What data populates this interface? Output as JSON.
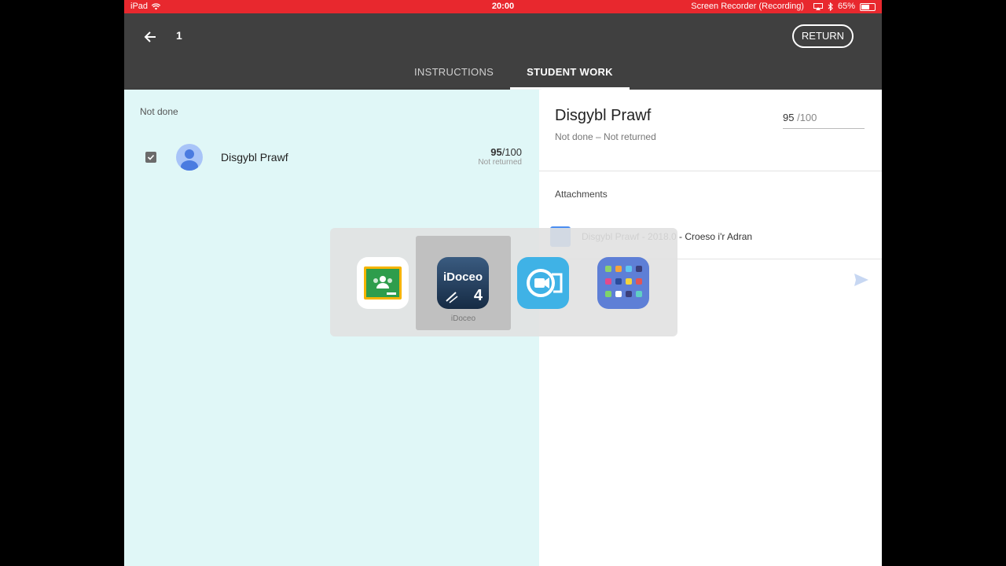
{
  "status_bar": {
    "device": "iPad",
    "time": "20:00",
    "recording": "Screen Recorder (Recording)",
    "battery": "65%",
    "battery_level": 0.65
  },
  "app_bar": {
    "page_number": "1",
    "return_label": "RETURN",
    "tabs": [
      {
        "label": "INSTRUCTIONS",
        "active": false
      },
      {
        "label": "STUDENT WORK",
        "active": true
      }
    ]
  },
  "student_list": {
    "section_label": "Not done",
    "students": [
      {
        "name": "Disgybl Prawf",
        "score": "95",
        "max": "/100",
        "status": "Not returned",
        "checked": true
      }
    ]
  },
  "detail": {
    "student_name": "Disgybl Prawf",
    "status": "Not done – Not returned",
    "grade_value": "95",
    "grade_max": "/100",
    "attachments_label": "Attachments",
    "attachment_title": "Disgybl Prawf - 2018.0 - Croeso i'r Adran"
  },
  "app_switcher": {
    "apps": [
      {
        "icon": "google-classroom-icon",
        "name": "",
        "selected": false
      },
      {
        "icon": "idoceo-icon",
        "name": "iDoceo",
        "selected": true,
        "logo_text": "iDoceo",
        "logo_number": "4"
      },
      {
        "icon": "screen-recorder-icon",
        "name": "",
        "selected": false
      },
      {
        "icon": "app-folder-icon",
        "name": "",
        "selected": false
      }
    ]
  },
  "colors": {
    "status_bar": "#e8282e",
    "app_bar": "#404040",
    "left_pane": "#e0f7f7",
    "classroom_green": "#2e9d4c",
    "idoceo_blue": "#1e3a5a",
    "recorder_blue": "#3fb2e6"
  }
}
